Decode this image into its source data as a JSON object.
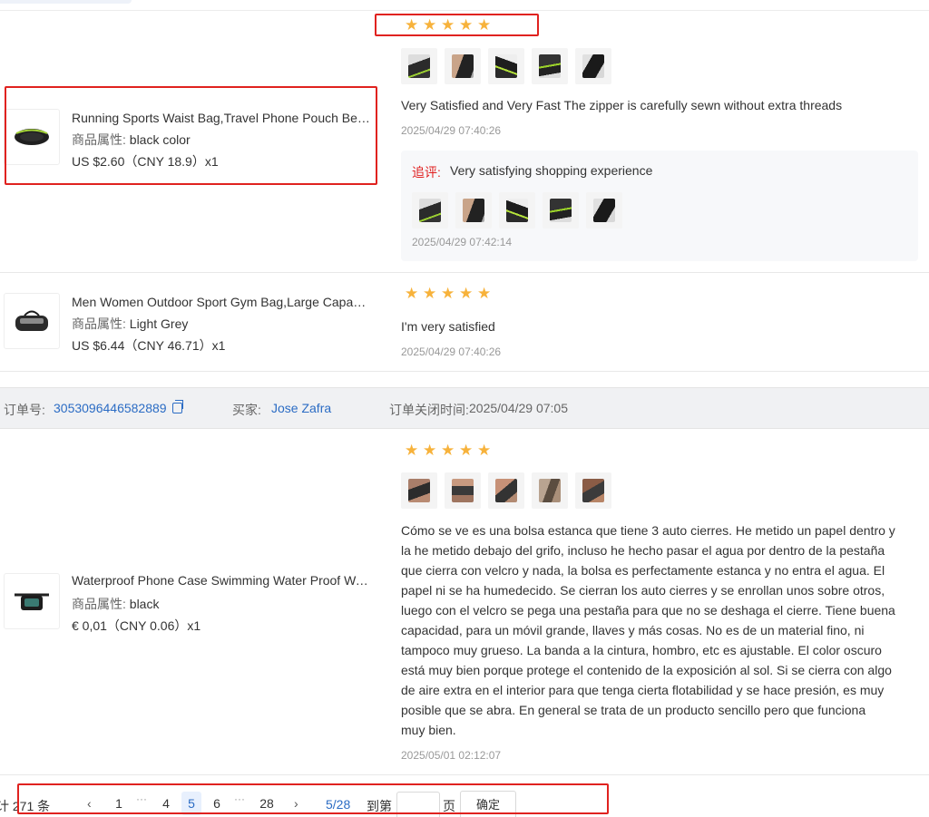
{
  "reviews": [
    {
      "rating": 5,
      "product": {
        "title": "Running Sports Waist Bag,Travel Phone Pouch Belt,Fanny Pack",
        "attr_label": "商品属性:",
        "attr_value": "black color",
        "price": "US $2.60（CNY  18.9）x1"
      },
      "text": "Very Satisfied and Very Fast The zipper is carefully sewn without extra threads",
      "date": "2025/04/29 07:40:26",
      "followup": {
        "label": "追评:",
        "text": "Very satisfying shopping experience",
        "date": "2025/04/29 07:42:14"
      }
    },
    {
      "rating": 5,
      "product": {
        "title": "Men Women Outdoor Sport Gym Bag,Large Capacity Travel Duffel",
        "attr_label": "商品属性:",
        "attr_value": "Light Grey",
        "price": "US $6.44（CNY  46.71）x1"
      },
      "text": "I'm very satisfied",
      "date": "2025/04/29 07:40:26"
    },
    {
      "rating": 5,
      "product": {
        "title": "Waterproof Phone Case Swimming Water Proof Waist Bag",
        "attr_label": "商品属性:",
        "attr_value": "black",
        "price": "€ 0,01（CNY  0.06）x1"
      },
      "text_lines": [
        "Cómo se ve es una bolsa estanca que tiene 3 auto cierres. He metido un papel dentro y",
        "la he metido debajo del grifo, incluso he hecho pasar el agua por dentro de la pestaña",
        "que cierra con velcro y nada, la bolsa es perfectamente estanca y no entra el agua. El",
        "papel ni se ha humedecido. Se cierran los auto cierres y se enrollan unos sobre otros,",
        "luego con el velcro se pega una pestaña para que no se deshaga el cierre. Tiene buena",
        "capacidad, para un móvil grande, llaves y más cosas. No es de un material fino, ni",
        "tampoco muy grueso. La banda a la cintura, hombro, etc es ajustable. El color oscuro",
        "está muy bien porque protege el contenido de la exposición al sol. Si se cierra con algo",
        "de aire extra en el interior para que tenga cierta flotabilidad y se hace presión, es muy",
        "posible que se abra. En general se trata de un producto sencillo pero que funciona",
        "muy bien."
      ],
      "date": "2025/05/01 02:12:07"
    }
  ],
  "order": {
    "id_label": "订单号:",
    "id": "3053096446582889",
    "buyer_label": "买家:",
    "buyer": "Jose Zafra",
    "closed_label": "订单关闭时间:",
    "closed": "2025/04/29 07:05"
  },
  "pagination": {
    "total": "计 271 条",
    "pages": [
      "1",
      "4",
      "5",
      "6",
      "28"
    ],
    "current": "5",
    "counter": "5/28",
    "goto_label": "到第",
    "page_unit": "页",
    "confirm": "确定"
  },
  "colors": {
    "star": "#f7b23b",
    "link": "#2b6cc4",
    "highlight_box": "#e0221f",
    "followup_label": "#e02020"
  }
}
